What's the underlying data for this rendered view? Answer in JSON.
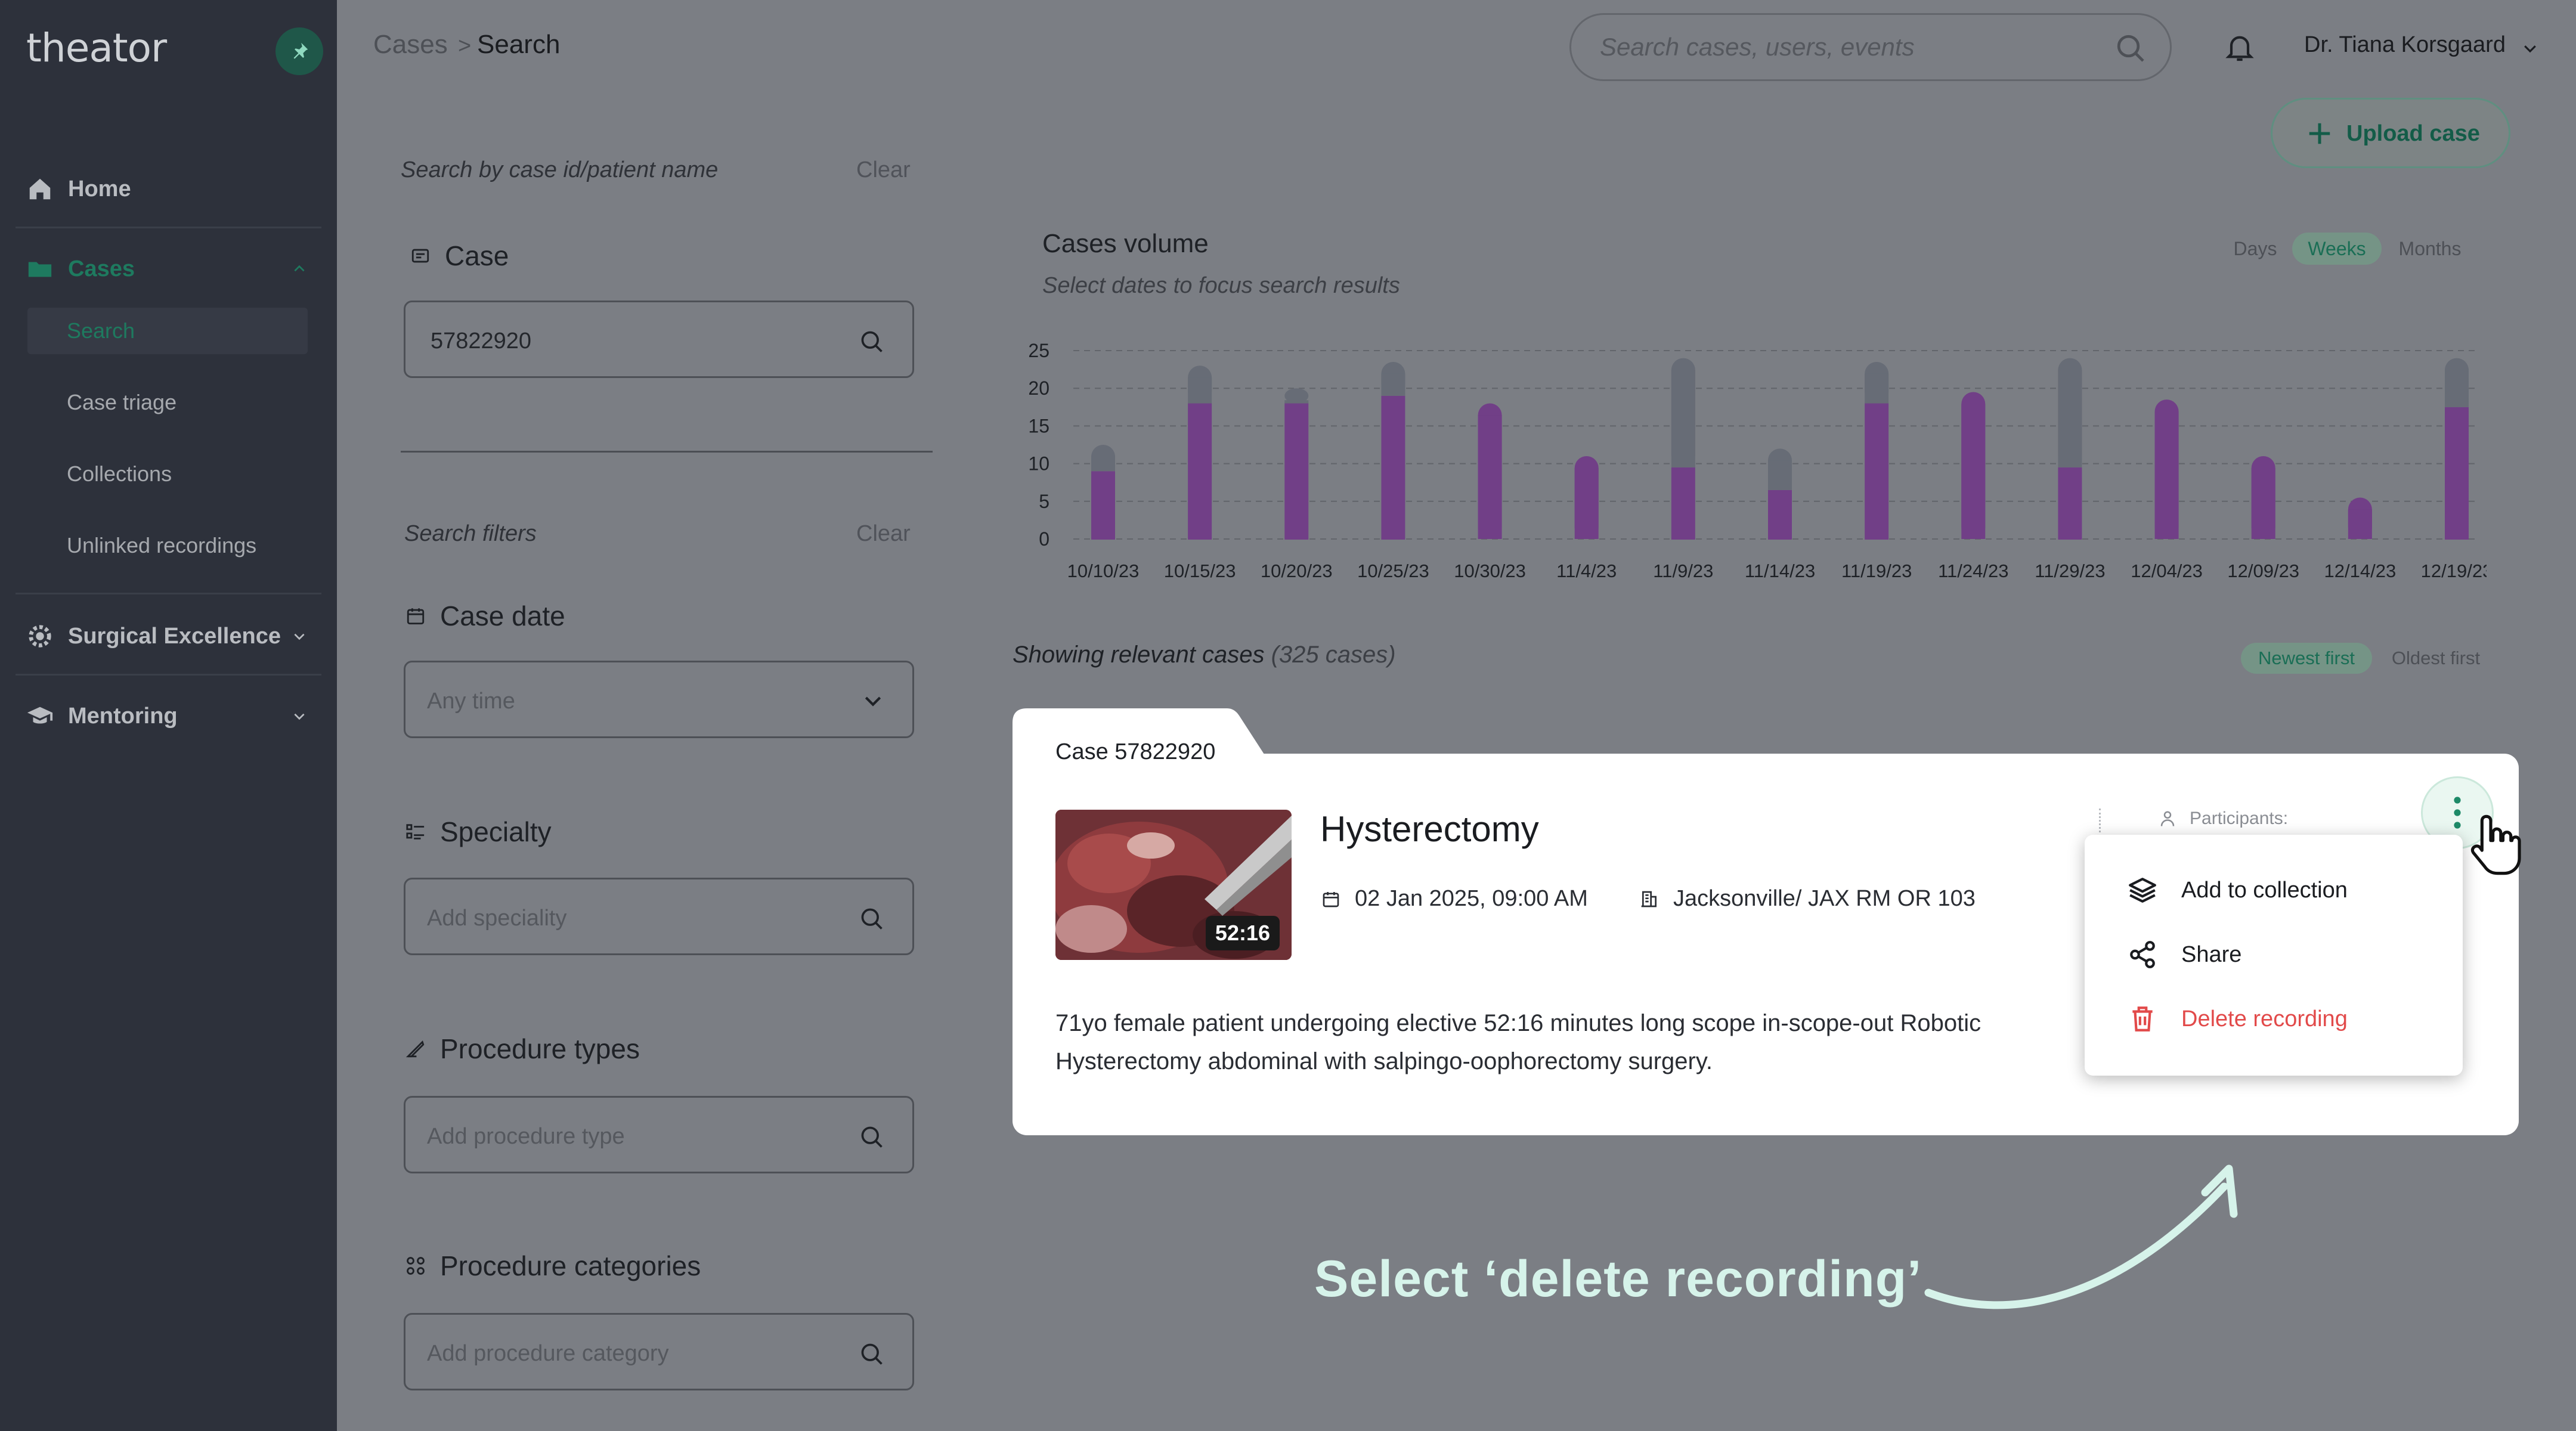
{
  "app": {
    "logo_text": "theator"
  },
  "sidebar": {
    "items": [
      {
        "label": "Home",
        "icon": "home-icon"
      },
      {
        "label": "Cases",
        "icon": "folder-icon",
        "sub": [
          "Search",
          "Case triage",
          "Collections",
          "Unlinked recordings"
        ]
      },
      {
        "label": "Surgical Excellence",
        "icon": "gear-icon"
      },
      {
        "label": "Mentoring",
        "icon": "graduation-cap-icon"
      }
    ]
  },
  "header": {
    "breadcrumb_root": "Cases",
    "breadcrumb_sep": ">",
    "breadcrumb_current": "Search",
    "search_placeholder": "Search cases, users, events",
    "user_name": "Dr. Tiana Korsgaard",
    "upload_label": "Upload case"
  },
  "filters": {
    "search_label": "Search by case id/patient name",
    "clear_1": "Clear",
    "case_title": "Case",
    "case_value": "57822920",
    "filters_label": "Search filters",
    "clear_2": "Clear",
    "date_title": "Case date",
    "date_value": "Any time",
    "specialty_title": "Specialty",
    "specialty_placeholder": "Add speciality",
    "proc_types_title": "Procedure types",
    "proc_types_placeholder": "Add procedure type",
    "proc_cat_title": "Procedure categories",
    "proc_cat_placeholder": "Add procedure category"
  },
  "chart_header": {
    "title": "Cases volume",
    "subtitle": "Select dates to focus search results",
    "toggles": [
      "Days",
      "Weeks",
      "Months"
    ],
    "active_toggle": "Weeks"
  },
  "chart_data": {
    "type": "bar",
    "title": "Cases volume",
    "categories": [
      "10/10/23",
      "10/15/23",
      "10/20/23",
      "10/25/23",
      "10/30/23",
      "11/4/23",
      "11/9/23",
      "11/14/23",
      "11/19/23",
      "11/24/23",
      "11/29/23",
      "12/04/23",
      "12/09/23",
      "12/14/23",
      "12/19/23"
    ],
    "series": [
      {
        "values": [
          9,
          18,
          18,
          19,
          18,
          11,
          9.5,
          6.5,
          18,
          19.5,
          9.5,
          18.5,
          11,
          5.5,
          17.5
        ],
        "color": "#713f87"
      },
      {
        "values": [
          3.5,
          5,
          2,
          4.5,
          0,
          0,
          14.5,
          5.5,
          5.5,
          0,
          14.5,
          0,
          0,
          0,
          6.5
        ],
        "color": "#676c76"
      }
    ],
    "stacked": true,
    "yticks": [
      0,
      5,
      10,
      15,
      20,
      25
    ],
    "ylim": [
      0,
      25
    ],
    "grid": true
  },
  "results": {
    "showing_label": "Showing relevant cases",
    "count_label": "(325 cases)",
    "sort_options": [
      "Newest first",
      "Oldest first"
    ],
    "active_sort": "Newest first"
  },
  "case_card": {
    "case_id": "Case 57822920",
    "duration": "52:16",
    "procedure": "Hysterectomy",
    "date": "02 Jan 2025, 09:00 AM",
    "location": "Jacksonville/ JAX RM OR 103",
    "participants_label": "Participants:",
    "description": "71yo female patient undergoing elective 52:16 minutes long scope in-scope-out Robotic Hysterectomy abdominal with salpingo-oophorectomy surgery."
  },
  "context_menu": {
    "items": [
      {
        "label": "Add to  collection",
        "icon": "layers-icon"
      },
      {
        "label": "Share",
        "icon": "share-icon"
      },
      {
        "label": "Delete recording",
        "icon": "trash-icon",
        "danger": true
      }
    ]
  },
  "annotation": {
    "text": "Select ‘delete recording’"
  },
  "colors": {
    "accent": "#2f8a6e",
    "danger": "#e24a4a",
    "bar_primary": "#713f87",
    "bar_secondary": "#676c76",
    "sidebar_bg": "#2d313b"
  }
}
